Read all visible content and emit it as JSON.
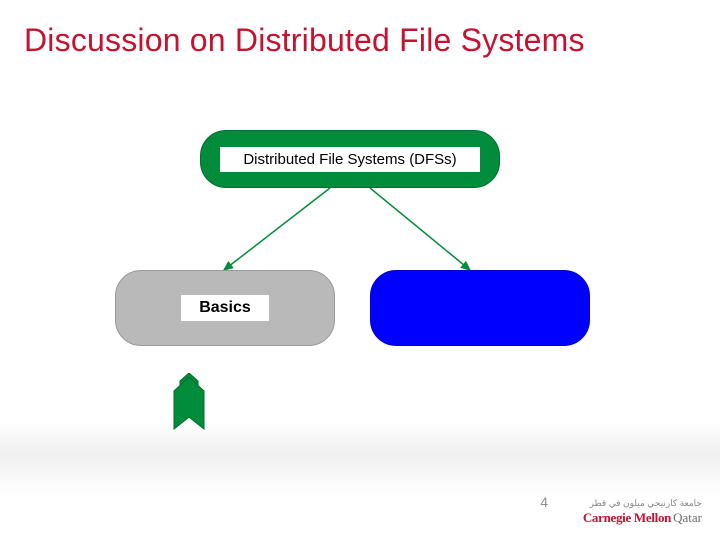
{
  "title": "Discussion on Distributed File Systems",
  "diagram": {
    "root_label": "Distributed File Systems (DFSs)",
    "left_label": "Basics",
    "right_label": ""
  },
  "colors": {
    "title": "#c41230",
    "root_fill": "#008c3a",
    "left_fill": "#b9b9b9",
    "right_fill": "#0000ff",
    "arrow": "#008c3a",
    "bookmark": "#008c3a"
  },
  "page_number": "4",
  "logo": {
    "arabic": "جامعة كارنيجي ميلون في قطر",
    "line1": "Carnegie Mellon",
    "line2": "Qatar"
  }
}
